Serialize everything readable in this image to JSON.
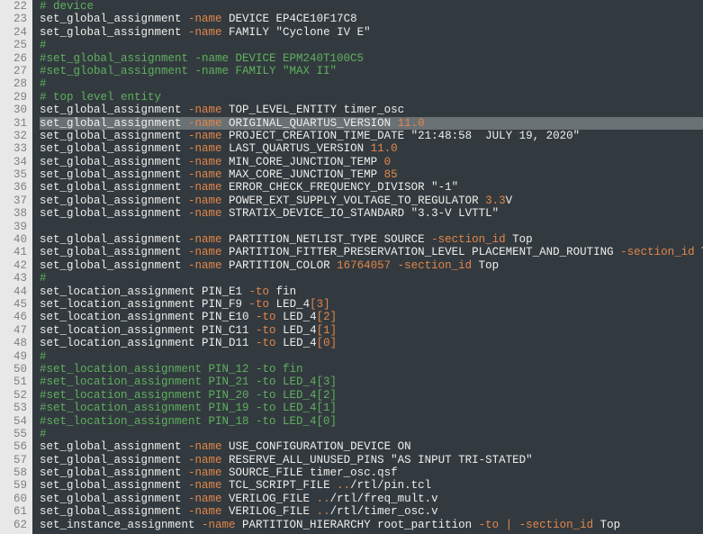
{
  "lines": [
    {
      "n": 22,
      "seg": [
        {
          "c": "cmt",
          "t": "# device"
        }
      ]
    },
    {
      "n": 23,
      "seg": [
        {
          "c": "kw",
          "t": "set_global_assignment "
        },
        {
          "c": "opt",
          "t": "-name"
        },
        {
          "c": "kw",
          "t": " DEVICE EP4CE10F17C8"
        }
      ]
    },
    {
      "n": 24,
      "seg": [
        {
          "c": "kw",
          "t": "set_global_assignment "
        },
        {
          "c": "opt",
          "t": "-name"
        },
        {
          "c": "kw",
          "t": " FAMILY \"Cyclone IV E\""
        }
      ]
    },
    {
      "n": 25,
      "seg": [
        {
          "c": "cmt",
          "t": "#"
        }
      ]
    },
    {
      "n": 26,
      "seg": [
        {
          "c": "cmt",
          "t": "#set_global_assignment -name DEVICE EPM240T100C5"
        }
      ]
    },
    {
      "n": 27,
      "seg": [
        {
          "c": "cmt",
          "t": "#set_global_assignment -name FAMILY \"MAX II\""
        }
      ]
    },
    {
      "n": 28,
      "seg": [
        {
          "c": "cmt",
          "t": "#"
        }
      ]
    },
    {
      "n": 29,
      "seg": [
        {
          "c": "cmt",
          "t": "# top level entity"
        }
      ]
    },
    {
      "n": 30,
      "seg": [
        {
          "c": "kw",
          "t": "set_global_assignment "
        },
        {
          "c": "opt",
          "t": "-name"
        },
        {
          "c": "kw",
          "t": " TOP_LEVEL_ENTITY timer_osc"
        }
      ]
    },
    {
      "n": 31,
      "hl": true,
      "seg": [
        {
          "c": "kw",
          "t": "set_global_assignment "
        },
        {
          "c": "opt",
          "t": "-name"
        },
        {
          "c": "kw",
          "t": " ORIGINAL_QUARTUS_VERSION "
        },
        {
          "c": "num",
          "t": "11.0"
        }
      ]
    },
    {
      "n": 32,
      "seg": [
        {
          "c": "kw",
          "t": "set_global_assignment "
        },
        {
          "c": "opt",
          "t": "-name"
        },
        {
          "c": "kw",
          "t": " PROJECT_CREATION_TIME_DATE \"21:48:58  JULY 19, 2020\""
        }
      ]
    },
    {
      "n": 33,
      "seg": [
        {
          "c": "kw",
          "t": "set_global_assignment "
        },
        {
          "c": "opt",
          "t": "-name"
        },
        {
          "c": "kw",
          "t": " LAST_QUARTUS_VERSION "
        },
        {
          "c": "num",
          "t": "11.0"
        }
      ]
    },
    {
      "n": 34,
      "seg": [
        {
          "c": "kw",
          "t": "set_global_assignment "
        },
        {
          "c": "opt",
          "t": "-name"
        },
        {
          "c": "kw",
          "t": " MIN_CORE_JUNCTION_TEMP "
        },
        {
          "c": "num",
          "t": "0"
        }
      ]
    },
    {
      "n": 35,
      "seg": [
        {
          "c": "kw",
          "t": "set_global_assignment "
        },
        {
          "c": "opt",
          "t": "-name"
        },
        {
          "c": "kw",
          "t": " MAX_CORE_JUNCTION_TEMP "
        },
        {
          "c": "num",
          "t": "85"
        }
      ]
    },
    {
      "n": 36,
      "seg": [
        {
          "c": "kw",
          "t": "set_global_assignment "
        },
        {
          "c": "opt",
          "t": "-name"
        },
        {
          "c": "kw",
          "t": " ERROR_CHECK_FREQUENCY_DIVISOR \"-1\""
        }
      ]
    },
    {
      "n": 37,
      "seg": [
        {
          "c": "kw",
          "t": "set_global_assignment "
        },
        {
          "c": "opt",
          "t": "-name"
        },
        {
          "c": "kw",
          "t": " POWER_EXT_SUPPLY_VOLTAGE_TO_REGULATOR "
        },
        {
          "c": "num",
          "t": "3.3"
        },
        {
          "c": "kw",
          "t": "V"
        }
      ]
    },
    {
      "n": 38,
      "seg": [
        {
          "c": "kw",
          "t": "set_global_assignment "
        },
        {
          "c": "opt",
          "t": "-name"
        },
        {
          "c": "kw",
          "t": " STRATIX_DEVICE_IO_STANDARD \"3.3-V LVTTL\""
        }
      ]
    },
    {
      "n": 39,
      "seg": []
    },
    {
      "n": 40,
      "seg": [
        {
          "c": "kw",
          "t": "set_global_assignment "
        },
        {
          "c": "opt",
          "t": "-name"
        },
        {
          "c": "kw",
          "t": " PARTITION_NETLIST_TYPE SOURCE "
        },
        {
          "c": "opt",
          "t": "-section_id"
        },
        {
          "c": "kw",
          "t": " Top"
        }
      ]
    },
    {
      "n": 41,
      "seg": [
        {
          "c": "kw",
          "t": "set_global_assignment "
        },
        {
          "c": "opt",
          "t": "-name"
        },
        {
          "c": "kw",
          "t": " PARTITION_FITTER_PRESERVATION_LEVEL PLACEMENT_AND_ROUTING "
        },
        {
          "c": "opt",
          "t": "-section_id"
        },
        {
          "c": "kw",
          "t": " Top"
        }
      ]
    },
    {
      "n": 42,
      "seg": [
        {
          "c": "kw",
          "t": "set_global_assignment "
        },
        {
          "c": "opt",
          "t": "-name"
        },
        {
          "c": "kw",
          "t": " PARTITION_COLOR "
        },
        {
          "c": "num",
          "t": "16764057"
        },
        {
          "c": "kw",
          "t": " "
        },
        {
          "c": "opt",
          "t": "-section_id"
        },
        {
          "c": "kw",
          "t": " Top"
        }
      ]
    },
    {
      "n": 43,
      "seg": [
        {
          "c": "cmt",
          "t": "#"
        }
      ]
    },
    {
      "n": 44,
      "seg": [
        {
          "c": "kw",
          "t": "set_location_assignment PIN_E1 "
        },
        {
          "c": "opt",
          "t": "-to"
        },
        {
          "c": "kw",
          "t": " fin"
        }
      ]
    },
    {
      "n": 45,
      "seg": [
        {
          "c": "kw",
          "t": "set_location_assignment PIN_F9 "
        },
        {
          "c": "opt",
          "t": "-to"
        },
        {
          "c": "kw",
          "t": " LED_4"
        },
        {
          "c": "br",
          "t": "["
        },
        {
          "c": "num",
          "t": "3"
        },
        {
          "c": "br",
          "t": "]"
        }
      ]
    },
    {
      "n": 46,
      "seg": [
        {
          "c": "kw",
          "t": "set_location_assignment PIN_E10 "
        },
        {
          "c": "opt",
          "t": "-to"
        },
        {
          "c": "kw",
          "t": " LED_4"
        },
        {
          "c": "br",
          "t": "["
        },
        {
          "c": "num",
          "t": "2"
        },
        {
          "c": "br",
          "t": "]"
        }
      ]
    },
    {
      "n": 47,
      "seg": [
        {
          "c": "kw",
          "t": "set_location_assignment PIN_C11 "
        },
        {
          "c": "opt",
          "t": "-to"
        },
        {
          "c": "kw",
          "t": " LED_4"
        },
        {
          "c": "br",
          "t": "["
        },
        {
          "c": "num",
          "t": "1"
        },
        {
          "c": "br",
          "t": "]"
        }
      ]
    },
    {
      "n": 48,
      "seg": [
        {
          "c": "kw",
          "t": "set_location_assignment PIN_D11 "
        },
        {
          "c": "opt",
          "t": "-to"
        },
        {
          "c": "kw",
          "t": " LED_4"
        },
        {
          "c": "br",
          "t": "["
        },
        {
          "c": "num",
          "t": "0"
        },
        {
          "c": "br",
          "t": "]"
        }
      ]
    },
    {
      "n": 49,
      "seg": [
        {
          "c": "cmt",
          "t": "#"
        }
      ]
    },
    {
      "n": 50,
      "seg": [
        {
          "c": "cmt",
          "t": "#set_location_assignment PIN_12 -to fin"
        }
      ]
    },
    {
      "n": 51,
      "seg": [
        {
          "c": "cmt",
          "t": "#set_location_assignment PIN_21 -to LED_4[3]"
        }
      ]
    },
    {
      "n": 52,
      "seg": [
        {
          "c": "cmt",
          "t": "#set_location_assignment PIN_20 -to LED_4[2]"
        }
      ]
    },
    {
      "n": 53,
      "seg": [
        {
          "c": "cmt",
          "t": "#set_location_assignment PIN_19 -to LED_4[1]"
        }
      ]
    },
    {
      "n": 54,
      "seg": [
        {
          "c": "cmt",
          "t": "#set_location_assignment PIN_18 -to LED_4[0]"
        }
      ]
    },
    {
      "n": 55,
      "seg": [
        {
          "c": "cmt",
          "t": "#"
        }
      ]
    },
    {
      "n": 56,
      "seg": [
        {
          "c": "kw",
          "t": "set_global_assignment "
        },
        {
          "c": "opt",
          "t": "-name"
        },
        {
          "c": "kw",
          "t": " USE_CONFIGURATION_DEVICE ON"
        }
      ]
    },
    {
      "n": 57,
      "seg": [
        {
          "c": "kw",
          "t": "set_global_assignment "
        },
        {
          "c": "opt",
          "t": "-name"
        },
        {
          "c": "kw",
          "t": " RESERVE_ALL_UNUSED_PINS \"AS INPUT TRI-STATED\""
        }
      ]
    },
    {
      "n": 58,
      "seg": [
        {
          "c": "kw",
          "t": "set_global_assignment "
        },
        {
          "c": "opt",
          "t": "-name"
        },
        {
          "c": "kw",
          "t": " SOURCE_FILE timer_osc.qsf"
        }
      ]
    },
    {
      "n": 59,
      "seg": [
        {
          "c": "kw",
          "t": "set_global_assignment "
        },
        {
          "c": "opt",
          "t": "-name"
        },
        {
          "c": "kw",
          "t": " TCL_SCRIPT_FILE "
        },
        {
          "c": "opt",
          "t": ".."
        },
        {
          "c": "kw",
          "t": "/rtl/pin.tcl"
        }
      ]
    },
    {
      "n": 60,
      "seg": [
        {
          "c": "kw",
          "t": "set_global_assignment "
        },
        {
          "c": "opt",
          "t": "-name"
        },
        {
          "c": "kw",
          "t": " VERILOG_FILE "
        },
        {
          "c": "opt",
          "t": ".."
        },
        {
          "c": "kw",
          "t": "/rtl/freq_mult.v"
        }
      ]
    },
    {
      "n": 61,
      "seg": [
        {
          "c": "kw",
          "t": "set_global_assignment "
        },
        {
          "c": "opt",
          "t": "-name"
        },
        {
          "c": "kw",
          "t": " VERILOG_FILE "
        },
        {
          "c": "opt",
          "t": ".."
        },
        {
          "c": "kw",
          "t": "/rtl/timer_osc.v"
        }
      ]
    },
    {
      "n": 62,
      "seg": [
        {
          "c": "kw",
          "t": "set_instance_assignment "
        },
        {
          "c": "opt",
          "t": "-name"
        },
        {
          "c": "kw",
          "t": " PARTITION_HIERARCHY root_partition "
        },
        {
          "c": "opt",
          "t": "-to"
        },
        {
          "c": "kw",
          "t": " "
        },
        {
          "c": "opt",
          "t": "|"
        },
        {
          "c": "kw",
          "t": " "
        },
        {
          "c": "opt",
          "t": "-section_id"
        },
        {
          "c": "kw",
          "t": " Top"
        }
      ]
    }
  ]
}
